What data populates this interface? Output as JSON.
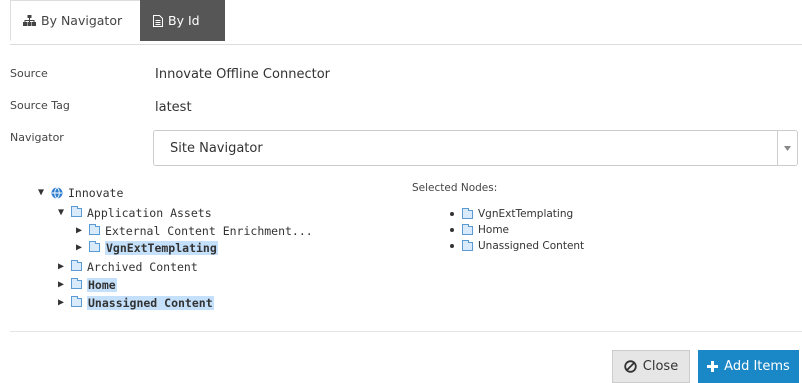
{
  "tabs": [
    {
      "label": "By Navigator",
      "icon": "sitemap-icon",
      "active": true
    },
    {
      "label": "By Id",
      "icon": "document-icon",
      "active": false
    }
  ],
  "form": {
    "source_label": "Source",
    "source_value": "Innovate Offline Connector",
    "source_tag_label": "Source Tag",
    "source_tag_value": "latest",
    "navigator_label": "Navigator",
    "navigator_value": "Site Navigator"
  },
  "tree": {
    "root": "Innovate",
    "nodes": [
      {
        "label": "Application Assets"
      },
      {
        "label": "External Content Enrichment..."
      },
      {
        "label": "VgnExtTemplating",
        "selected": true
      },
      {
        "label": "Archived Content"
      },
      {
        "label": "Home",
        "selected": true
      },
      {
        "label": "Unassigned Content",
        "selected": true
      }
    ]
  },
  "selected_nodes": {
    "title": "Selected Nodes:",
    "items": [
      "VgnExtTemplating",
      "Home",
      "Unassigned Content"
    ]
  },
  "buttons": {
    "close": "Close",
    "add": "Add Items"
  },
  "colors": {
    "accent": "#1a87c7",
    "tab_inactive": "#565656",
    "selection": "#c4e0fb"
  }
}
